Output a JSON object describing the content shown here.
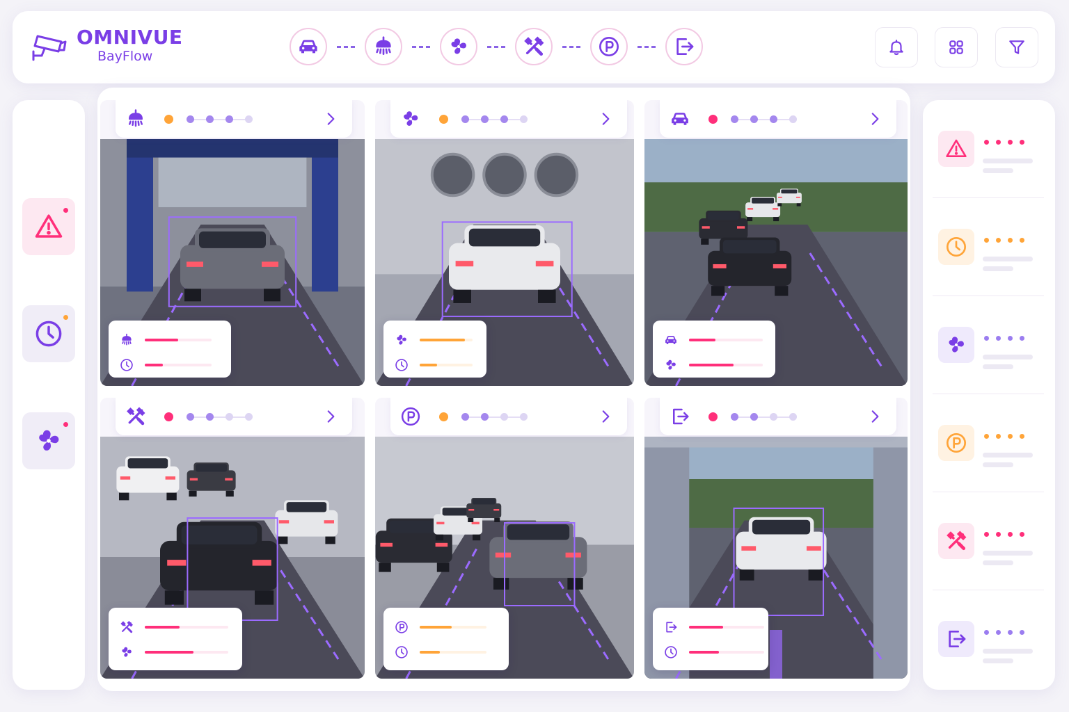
{
  "app": {
    "brand_name": "OMNIVUE",
    "brand_sub": "BayFlow"
  },
  "colors": {
    "accent": "#7a3ee6",
    "critical": "#ff2f7a",
    "warning": "#ffa438",
    "info": "#9b7df0"
  },
  "header": {
    "flow_steps": [
      "car-icon",
      "shower-icon",
      "fan-icon",
      "tools-icon",
      "parking-icon",
      "exit-icon"
    ],
    "actions": [
      "bell-icon",
      "grid-icon",
      "filter-icon"
    ]
  },
  "left_rail": [
    {
      "icon": "warning-icon",
      "status": "critical",
      "active": true
    },
    {
      "icon": "clock-icon",
      "status": "warning",
      "active": false
    },
    {
      "icon": "fan-icon",
      "status": "critical",
      "active": false
    }
  ],
  "right_rail": [
    {
      "icon": "warning-icon",
      "status": "critical"
    },
    {
      "icon": "clock-icon",
      "status": "warning"
    },
    {
      "icon": "fan-icon",
      "status": "info"
    },
    {
      "icon": "parking-icon",
      "status": "warning"
    },
    {
      "icon": "tools-icon",
      "status": "critical"
    },
    {
      "icon": "exit-icon",
      "status": "info"
    }
  ],
  "cameras": [
    {
      "zone": "wash-bay",
      "icon": "shower-icon",
      "status": "warning",
      "metrics": [
        {
          "icon": "shower-icon",
          "level": 0.5,
          "status": "critical"
        },
        {
          "icon": "clock-icon",
          "level": 0.27,
          "status": "critical"
        }
      ]
    },
    {
      "zone": "dry-bay",
      "icon": "fan-icon",
      "status": "warning",
      "metrics": [
        {
          "icon": "fan-icon",
          "level": 0.85,
          "status": "warning"
        },
        {
          "icon": "clock-icon",
          "level": 0.33,
          "status": "warning"
        }
      ]
    },
    {
      "zone": "entry-queue",
      "icon": "car-icon",
      "status": "critical",
      "metrics": [
        {
          "icon": "car-icon",
          "level": 0.36,
          "status": "critical"
        },
        {
          "icon": "fan-icon",
          "level": 0.6,
          "status": "critical"
        }
      ]
    },
    {
      "zone": "service-bay",
      "icon": "tools-icon",
      "status": "critical",
      "metrics": [
        {
          "icon": "tools-icon",
          "level": 0.42,
          "status": "critical"
        },
        {
          "icon": "fan-icon",
          "level": 0.58,
          "status": "critical"
        }
      ]
    },
    {
      "zone": "parking",
      "icon": "parking-icon",
      "status": "warning",
      "metrics": [
        {
          "icon": "parking-icon",
          "level": 0.48,
          "status": "warning"
        },
        {
          "icon": "clock-icon",
          "level": 0.3,
          "status": "warning"
        }
      ]
    },
    {
      "zone": "exit-lane",
      "icon": "exit-icon",
      "status": "critical",
      "metrics": [
        {
          "icon": "exit-icon",
          "level": 0.45,
          "status": "critical"
        },
        {
          "icon": "clock-icon",
          "level": 0.4,
          "status": "critical"
        }
      ]
    }
  ]
}
